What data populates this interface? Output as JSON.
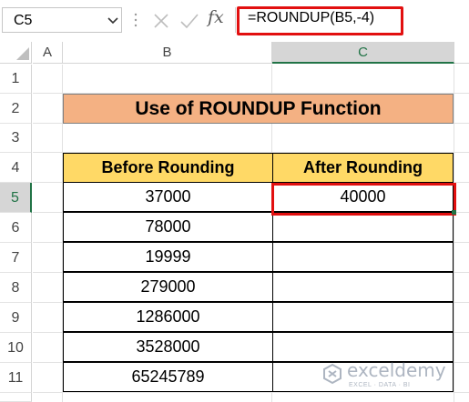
{
  "formula_bar": {
    "name_box": "C5",
    "formula": "=ROUNDUP(B5,-4)",
    "fx_label": "fx",
    "icons": {
      "cancel": "close-icon",
      "enter": "check-icon",
      "dropdown": "chevron-down-icon"
    }
  },
  "columns": [
    "A",
    "B",
    "C"
  ],
  "rows": [
    "1",
    "2",
    "3",
    "4",
    "5",
    "6",
    "7",
    "8",
    "9",
    "10",
    "11"
  ],
  "sheet": {
    "title": "Use of ROUNDUP Function",
    "headers": [
      "Before Rounding",
      "After Rounding"
    ],
    "before_values": [
      "37000",
      "78000",
      "19999",
      "279000",
      "1286000",
      "3528000",
      "65245789"
    ],
    "after_values": [
      "40000",
      "",
      "",
      "",
      "",
      "",
      ""
    ]
  },
  "colors": {
    "title_fill": "#f4b183",
    "header_fill": "#ffd966",
    "highlight": "#e21010",
    "excel_green": "#217346"
  },
  "watermark": {
    "name": "exceldemy",
    "tagline": "EXCEL · DATA · BI"
  }
}
